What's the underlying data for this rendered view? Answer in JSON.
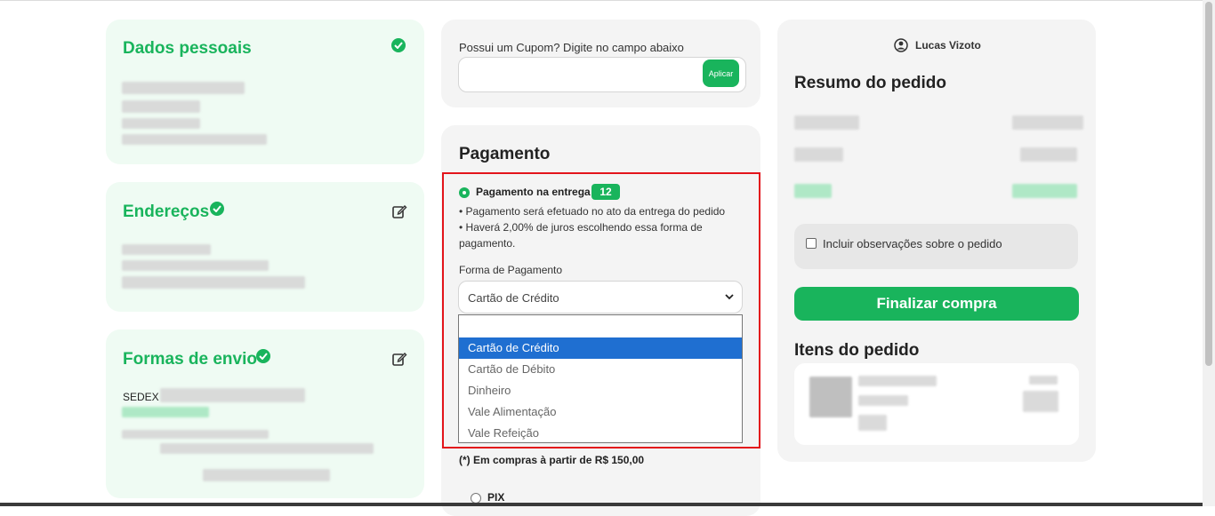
{
  "personal": {
    "title": "Dados pessoais"
  },
  "addresses": {
    "title": "Endereços"
  },
  "shipping": {
    "title": "Formas de envio",
    "method": "SEDEX"
  },
  "coupon": {
    "label": "Possui um Cupom? Digite no campo abaixo",
    "placeholder": "",
    "button": "Aplicar"
  },
  "payment": {
    "title": "Pagamento",
    "option_title": "Pagamento na entrega",
    "badge": "12",
    "bullets": [
      "• Pagamento será efetuado no ato da entrega do pedido",
      "• Haverá 2,00% de juros escolhendo essa forma de pagamento."
    ],
    "select_label": "Forma de Pagamento",
    "selected": "Cartão de Crédito",
    "options": [
      "Cartão de Crédito",
      "Cartão de Débito",
      "Dinheiro",
      "Vale Alimentação",
      "Vale Refeição"
    ],
    "note": "(*) Em compras à partir de R$ 150,00",
    "pix": "PIX"
  },
  "summary": {
    "user": "Lucas Vizoto",
    "title": "Resumo do pedido",
    "obs_label": "Incluir observações sobre o pedido",
    "finish": "Finalizar compra",
    "items_title": "Itens do pedido"
  },
  "colors": {
    "accent": "#19b45c",
    "highlight": "#e3141b",
    "selected_option": "#1f6fd1"
  },
  "icons": [
    "check-circle-icon",
    "edit-icon",
    "chevron-down-icon",
    "user-circle-icon"
  ]
}
